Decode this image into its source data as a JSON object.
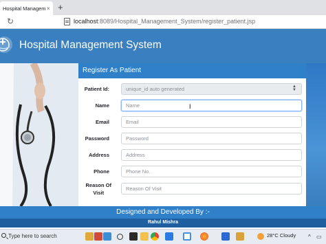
{
  "browser": {
    "tab_title": "Hospital Management S",
    "tab_close": "×",
    "new_tab": "+",
    "url_host": "localhost",
    "url_path": ":8089/Hospital_Management_System/register_patient.jsp"
  },
  "header": {
    "title": "Hospital Management System"
  },
  "form": {
    "title": "Register As Patient",
    "fields": [
      {
        "label": "Patient Id:",
        "placeholder": "unique_id auto generated"
      },
      {
        "label": "Name",
        "placeholder": "Name"
      },
      {
        "label": "Email",
        "placeholder": "Email"
      },
      {
        "label": "Password",
        "placeholder": "Password"
      },
      {
        "label": "Address",
        "placeholder": "Address"
      },
      {
        "label": "Phone",
        "placeholder": "Phone No."
      },
      {
        "label_line1": "Reason Of",
        "label_line2": "Visit",
        "placeholder": "Reason Of Visit"
      }
    ]
  },
  "footer": {
    "designed_by": "Designed and Developed By :-",
    "author": "Rahul Mishra"
  },
  "taskbar": {
    "search_placeholder": "Type here to search",
    "temperature": "28°C",
    "weather": "Cloudy"
  },
  "colors": {
    "header_blue": "#3a7fbf",
    "panel_blue": "#2f7fc9",
    "footer_dark": "#1f5fa0"
  }
}
